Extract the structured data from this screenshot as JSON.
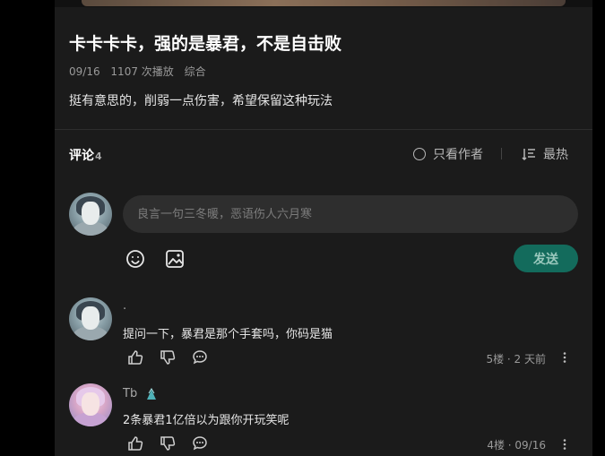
{
  "video": {
    "id_text": "10_0721f263-92c0-1f0-9892-00000000000c"
  },
  "post": {
    "title": "卡卡卡卡，强的是暴君，不是自击败",
    "date": "09/16",
    "plays": "1107 次播放",
    "category": "综合",
    "description": "挺有意思的，削弱一点伤害，希望保留这种玩法"
  },
  "comments_header": {
    "label": "评论",
    "count": "4",
    "author_only": "只看作者",
    "sort": "最热"
  },
  "composer": {
    "placeholder": "良言一句三冬暖，恶语伤人六月寒",
    "send_label": "发送"
  },
  "comments": [
    {
      "name": ".",
      "text": "提问一下，暴君是那个手套吗，你码是猫",
      "meta": "5楼 · 2 天前"
    },
    {
      "name": "Tb",
      "text": "2条暴君1亿倍以为跟你开玩笑呢",
      "meta": "4楼 · 09/16"
    }
  ],
  "colors": {
    "accent": "#136b5c",
    "panel": "#1b1b1b",
    "background": "#000000"
  },
  "icons": [
    "emoji-icon",
    "image-icon",
    "like-icon",
    "dislike-icon",
    "reply-icon",
    "more-icon",
    "sort-icon",
    "radio-icon"
  ]
}
